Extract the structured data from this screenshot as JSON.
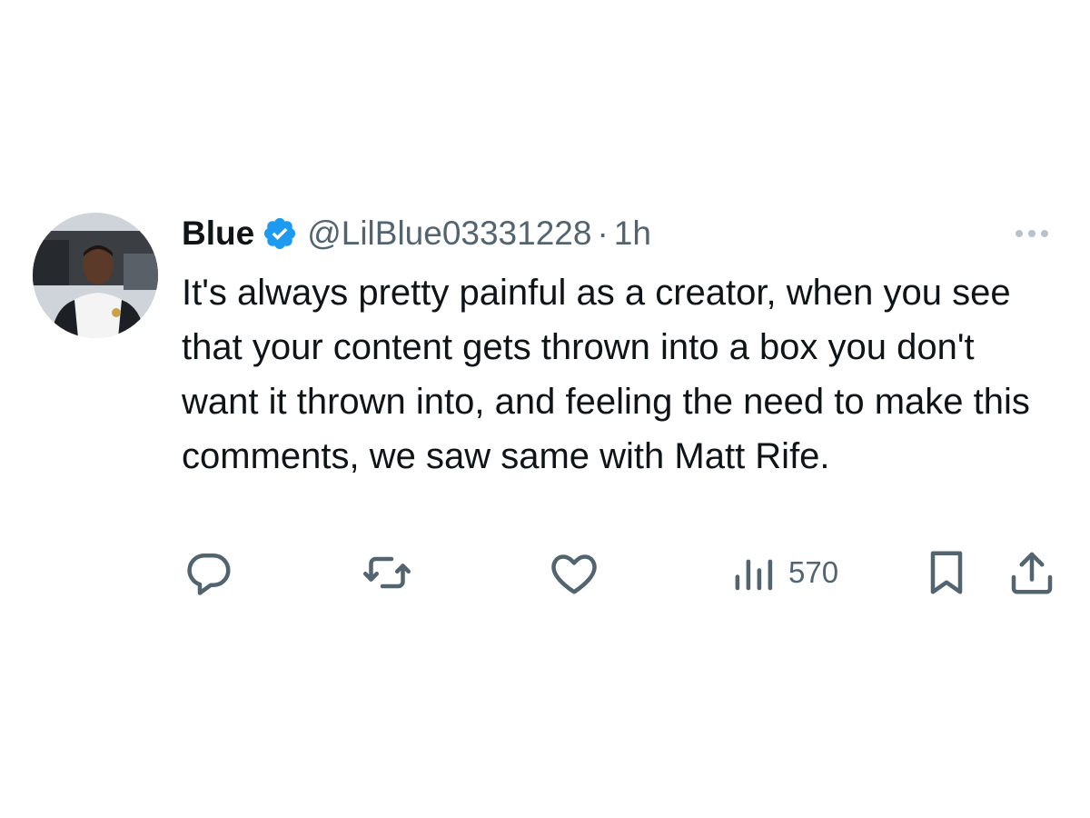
{
  "author": {
    "display_name": "Blue",
    "handle": "@LilBlue03331228",
    "separator": "·",
    "time": "1h",
    "verified": true
  },
  "tweet": {
    "text": "It's always pretty painful as a creator, when you see that your content gets thrown into a box you don't want it thrown into, and feeling the need to make this comments, we saw same with Matt Rife."
  },
  "actions": {
    "views": "570"
  },
  "icons": {
    "verified": "verified-badge-icon",
    "more": "more-dots-icon",
    "reply": "reply-icon",
    "retweet": "retweet-icon",
    "like": "heart-icon",
    "views": "analytics-bars-icon",
    "bookmark": "bookmark-icon",
    "share": "share-upload-icon"
  },
  "colors": {
    "verified_blue": "#1d9bf0",
    "secondary_text": "#536471",
    "primary_text": "#0f1419"
  }
}
